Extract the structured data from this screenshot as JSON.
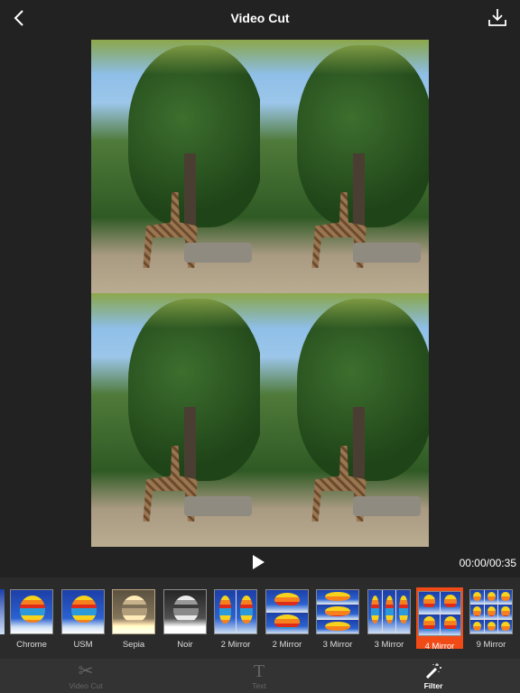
{
  "header": {
    "title": "Video Cut",
    "back_icon": "chevron-left-icon",
    "download_icon": "download-icon"
  },
  "player": {
    "time": "00:00/00:35",
    "play_icon": "play-icon"
  },
  "filters": [
    {
      "label": "Chrome",
      "style": "chrome"
    },
    {
      "label": "USM",
      "style": "usm"
    },
    {
      "label": "Sepia",
      "style": "sepia"
    },
    {
      "label": "Noir",
      "style": "noir"
    },
    {
      "label": "2 Mirror",
      "style": "mirror2v"
    },
    {
      "label": "2 Mirror",
      "style": "mirror2h"
    },
    {
      "label": "3 Mirror",
      "style": "mirror3h"
    },
    {
      "label": "3 Mirror",
      "style": "mirror3v"
    },
    {
      "label": "4 Mirror",
      "style": "mirror4",
      "selected": true
    },
    {
      "label": "9 Mirror",
      "style": "mirror9"
    }
  ],
  "selected_color": "#f04a17",
  "tabs": [
    {
      "label": "Video Cut",
      "icon": "scissors-icon"
    },
    {
      "label": "Text",
      "icon": "text-icon"
    },
    {
      "label": "Filter",
      "icon": "magic-wand-icon",
      "active": true
    }
  ]
}
